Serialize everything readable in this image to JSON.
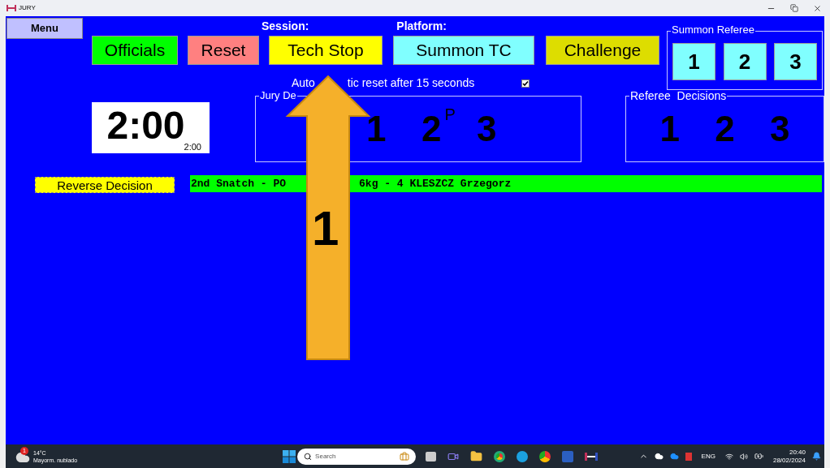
{
  "window": {
    "title": "JURY"
  },
  "menu_button": "Menu",
  "header_labels": [
    "Session:",
    "Platform:"
  ],
  "action_buttons": [
    {
      "label": "Officials",
      "color": "#00ff00"
    },
    {
      "label": "Reset",
      "color": "#ff8080"
    },
    {
      "label": "Tech Stop",
      "color": "#ffff00"
    },
    {
      "label": "Summon TC",
      "color": "#80ffff"
    },
    {
      "label": "Challenge",
      "color": "#dddd00"
    }
  ],
  "summon_referee": {
    "title": "Summon Referee",
    "buttons": [
      "1",
      "2",
      "3"
    ]
  },
  "auto_reset": {
    "text_parts": [
      "Auto",
      "tic reset after 15 seconds"
    ],
    "checked": true
  },
  "timer": {
    "main": "2:00",
    "sub": "2:00"
  },
  "jury_decisions": {
    "title": "Jury De",
    "items": [
      {
        "label": "1"
      },
      {
        "label": "2",
        "mark": "P"
      },
      {
        "label": "3"
      }
    ]
  },
  "referee_decisions": {
    "title": "Referee  Decisions",
    "items": [
      "1",
      "2",
      "3"
    ]
  },
  "reverse_button": "Reverse Decision",
  "current_attempt": {
    "text_parts": [
      "2nd Snatch - PO",
      "6kg - 4 KLESZCZ Grzegorz"
    ]
  },
  "annotation": {
    "label": "1"
  },
  "taskbar": {
    "weather": {
      "temp": "14°C",
      "desc": "Mayorm. nublado",
      "badge": "1"
    },
    "search_placeholder": "Search",
    "language": "ENG",
    "time": "20:40",
    "date": "28/02/2024"
  }
}
